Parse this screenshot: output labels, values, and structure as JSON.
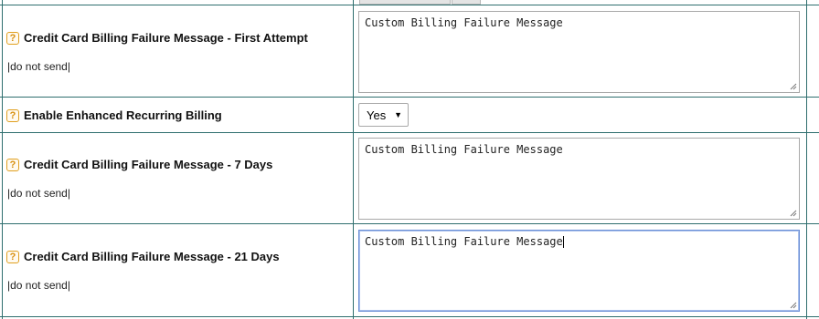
{
  "rows": [
    {
      "label": "Credit Card Billing Failure Message - First Attempt",
      "sub": "|do not send|",
      "value": "Custom Billing Failure Message"
    },
    {
      "label": "Enable Enhanced Recurring Billing",
      "select_value": "Yes"
    },
    {
      "label": "Credit Card Billing Failure Message - 7 Days",
      "sub": "|do not send|",
      "value": "Custom Billing Failure Message"
    },
    {
      "label": "Credit Card Billing Failure Message - 21 Days",
      "sub": "|do not send|",
      "value": "Custom Billing Failure Message"
    }
  ],
  "help_icon_glyph": "?",
  "select_caret": "▼"
}
